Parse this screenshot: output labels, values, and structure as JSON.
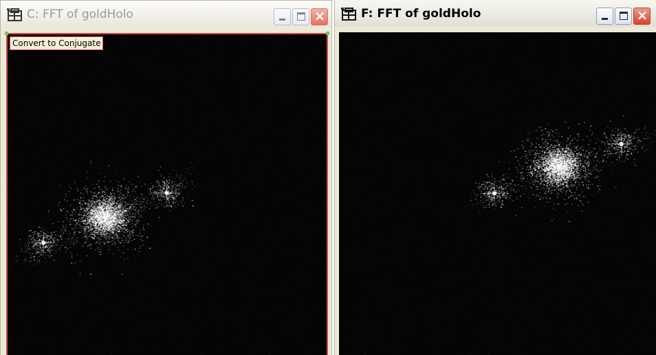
{
  "windows": [
    {
      "title": "C: FFT of goldHolo",
      "state": "inactive",
      "icon": "imaging-app-icon",
      "tooltip": "Convert to Conjugate",
      "buttons": {
        "minimize": "minimize-icon",
        "maximize": "maximize-icon",
        "close": "close-icon"
      }
    },
    {
      "title": "F: FFT of goldHolo",
      "state": "active",
      "icon": "imaging-app-icon",
      "buttons": {
        "minimize": "minimize-icon",
        "maximize": "maximize-icon",
        "close": "close-icon"
      }
    }
  ],
  "colors": {
    "canvas_bg": "#050505",
    "selection_border": "#d14a4a",
    "marker": "#6fc85a",
    "speckle": "#ffffff"
  }
}
